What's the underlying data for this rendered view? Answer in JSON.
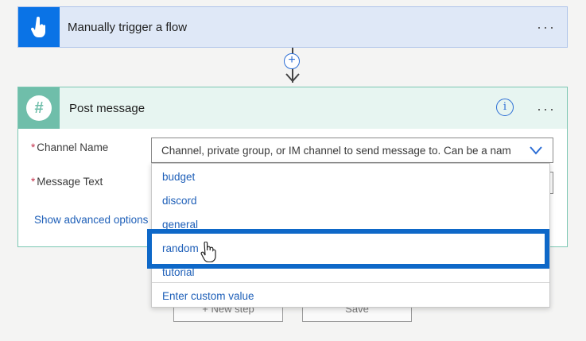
{
  "trigger": {
    "title": "Manually trigger a flow",
    "more": "···"
  },
  "connector": {
    "add": "+"
  },
  "action": {
    "title": "Post message",
    "info": "i",
    "more": "···",
    "channel_label": "Channel Name",
    "channel_placeholder": "Channel, private group, or IM channel to send message to. Can be a nam",
    "message_label": "Message Text",
    "advanced_link": "Show advanced options",
    "required_mark": "*"
  },
  "dropdown": {
    "items": [
      "budget",
      "discord",
      "general",
      "random",
      "tutorial"
    ],
    "custom": "Enter custom value",
    "highlighted": "random"
  },
  "bottom_buttons": {
    "new_step": "+ New step",
    "save": "Save"
  },
  "colors": {
    "trigger_icon": "#0a73e6",
    "action_icon": "#6fbeaa",
    "highlight": "#0e68c8"
  }
}
